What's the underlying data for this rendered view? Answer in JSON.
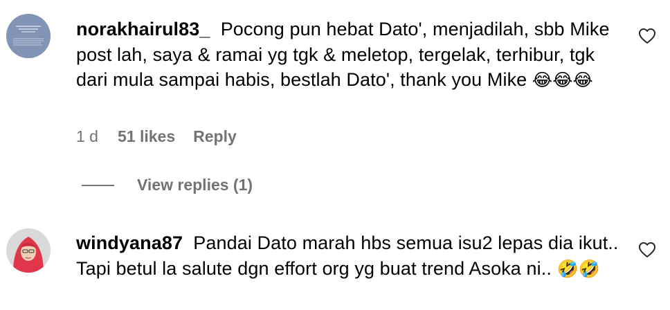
{
  "comments": [
    {
      "username": "norakhairul83_",
      "text": "Pocong pun hebat Dato', menjadilah, sbb Mike post lah, saya & ramai yg tgk & meletop, tergelak, terhibur, tgk dari mula sampai habis, bestlah Dato', thank you Mike",
      "emoji": "😂😂😂",
      "time": "1 d",
      "likes": "51 likes",
      "reply_label": "Reply",
      "view_replies": "View replies (1)",
      "avatar_icon": "quote-image-avatar",
      "like_icon": "heart-outline-icon"
    },
    {
      "username": "windyana87",
      "text": "Pandai Dato marah hbs semua isu2 lepas dia ikut.. Tapi betul la salute dgn effort org yg buat trend Asoka ni..",
      "emoji": "🤣🤣",
      "avatar_icon": "woman-hijab-avatar",
      "like_icon": "heart-outline-icon"
    }
  ],
  "colors": {
    "secondary_text": "#737373",
    "primary_text": "#000000",
    "avatar1_bg": "#7d8fb0",
    "avatar2_hijab": "#e0364a"
  }
}
